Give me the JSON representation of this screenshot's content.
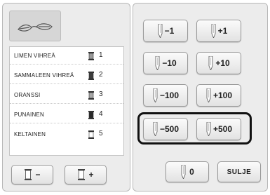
{
  "threads": [
    {
      "name": "LIMEN VIHREÄ",
      "number": "1",
      "spool_color": "#9a9a9a"
    },
    {
      "name": "SAMMALEEN VIHREÄ",
      "number": "2",
      "spool_color": "#3d3d3d"
    },
    {
      "name": "ORANSSI",
      "number": "3",
      "spool_color": "#a8a8a8"
    },
    {
      "name": "PUNAINEN",
      "number": "4",
      "spool_color": "#2a2a2a"
    },
    {
      "name": "KELTAINEN",
      "number": "5",
      "spool_color": "#cfcfcf"
    }
  ],
  "left_controls": {
    "decrease_label": "−",
    "increase_label": "+"
  },
  "adjust_buttons": {
    "minus_1": "−1",
    "plus_1": "+1",
    "minus_10": "−10",
    "plus_10": "+10",
    "minus_100": "−100",
    "plus_100": "+100",
    "minus_500": "−500",
    "plus_500": "+500"
  },
  "footer": {
    "reset_label": "0",
    "close_label": "SULJE"
  },
  "colors": {
    "panel": "#ececec",
    "highlight": "#111111"
  }
}
